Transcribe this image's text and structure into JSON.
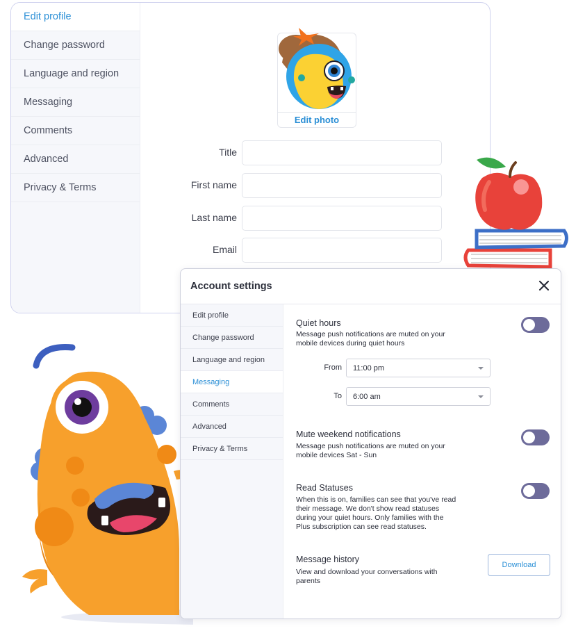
{
  "back_window": {
    "sidebar_items": [
      {
        "label": "Edit profile",
        "active": true
      },
      {
        "label": "Change password",
        "active": false
      },
      {
        "label": "Language and region",
        "active": false
      },
      {
        "label": "Messaging",
        "active": false
      },
      {
        "label": "Comments",
        "active": false
      },
      {
        "label": "Advanced",
        "active": false
      },
      {
        "label": "Privacy & Terms",
        "active": false
      }
    ],
    "edit_photo_label": "Edit photo",
    "fields": [
      {
        "label": "Title",
        "value": ""
      },
      {
        "label": "First name",
        "value": ""
      },
      {
        "label": "Last name",
        "value": ""
      },
      {
        "label": "Email",
        "value": ""
      }
    ]
  },
  "modal": {
    "title": "Account settings",
    "close_icon": "close-icon",
    "sidebar_items": [
      {
        "label": "Edit profile",
        "active": false
      },
      {
        "label": "Change password",
        "active": false
      },
      {
        "label": "Language and region",
        "active": false
      },
      {
        "label": "Messaging",
        "active": true
      },
      {
        "label": "Comments",
        "active": false
      },
      {
        "label": "Advanced",
        "active": false
      },
      {
        "label": "Privacy & Terms",
        "active": false
      }
    ],
    "quiet_hours": {
      "title": "Quiet hours",
      "description": "Message push notifications are muted on your mobile devices during quiet hours",
      "enabled": false,
      "from_label": "From",
      "from_value": "11:00 pm",
      "to_label": "To",
      "to_value": "6:00 am"
    },
    "mute_weekend": {
      "title": "Mute weekend notifications",
      "description": "Message push notifications are muted on your mobile devices Sat - Sun",
      "enabled": false
    },
    "read_statuses": {
      "title": "Read Statuses",
      "description": "When this is on, families can see that you've read their message. We don't show read statuses during your quiet hours. Only families with the Plus subscription can see read statuses.",
      "enabled": false
    },
    "message_history": {
      "title": "Message history",
      "description": "View and download your conversations with parents",
      "button_label": "Download"
    }
  },
  "colors": {
    "accent": "#2b8fd6",
    "toggle": "#6d6b9a",
    "monster_orange": "#f7a02c",
    "apple_red": "#e8423a"
  }
}
